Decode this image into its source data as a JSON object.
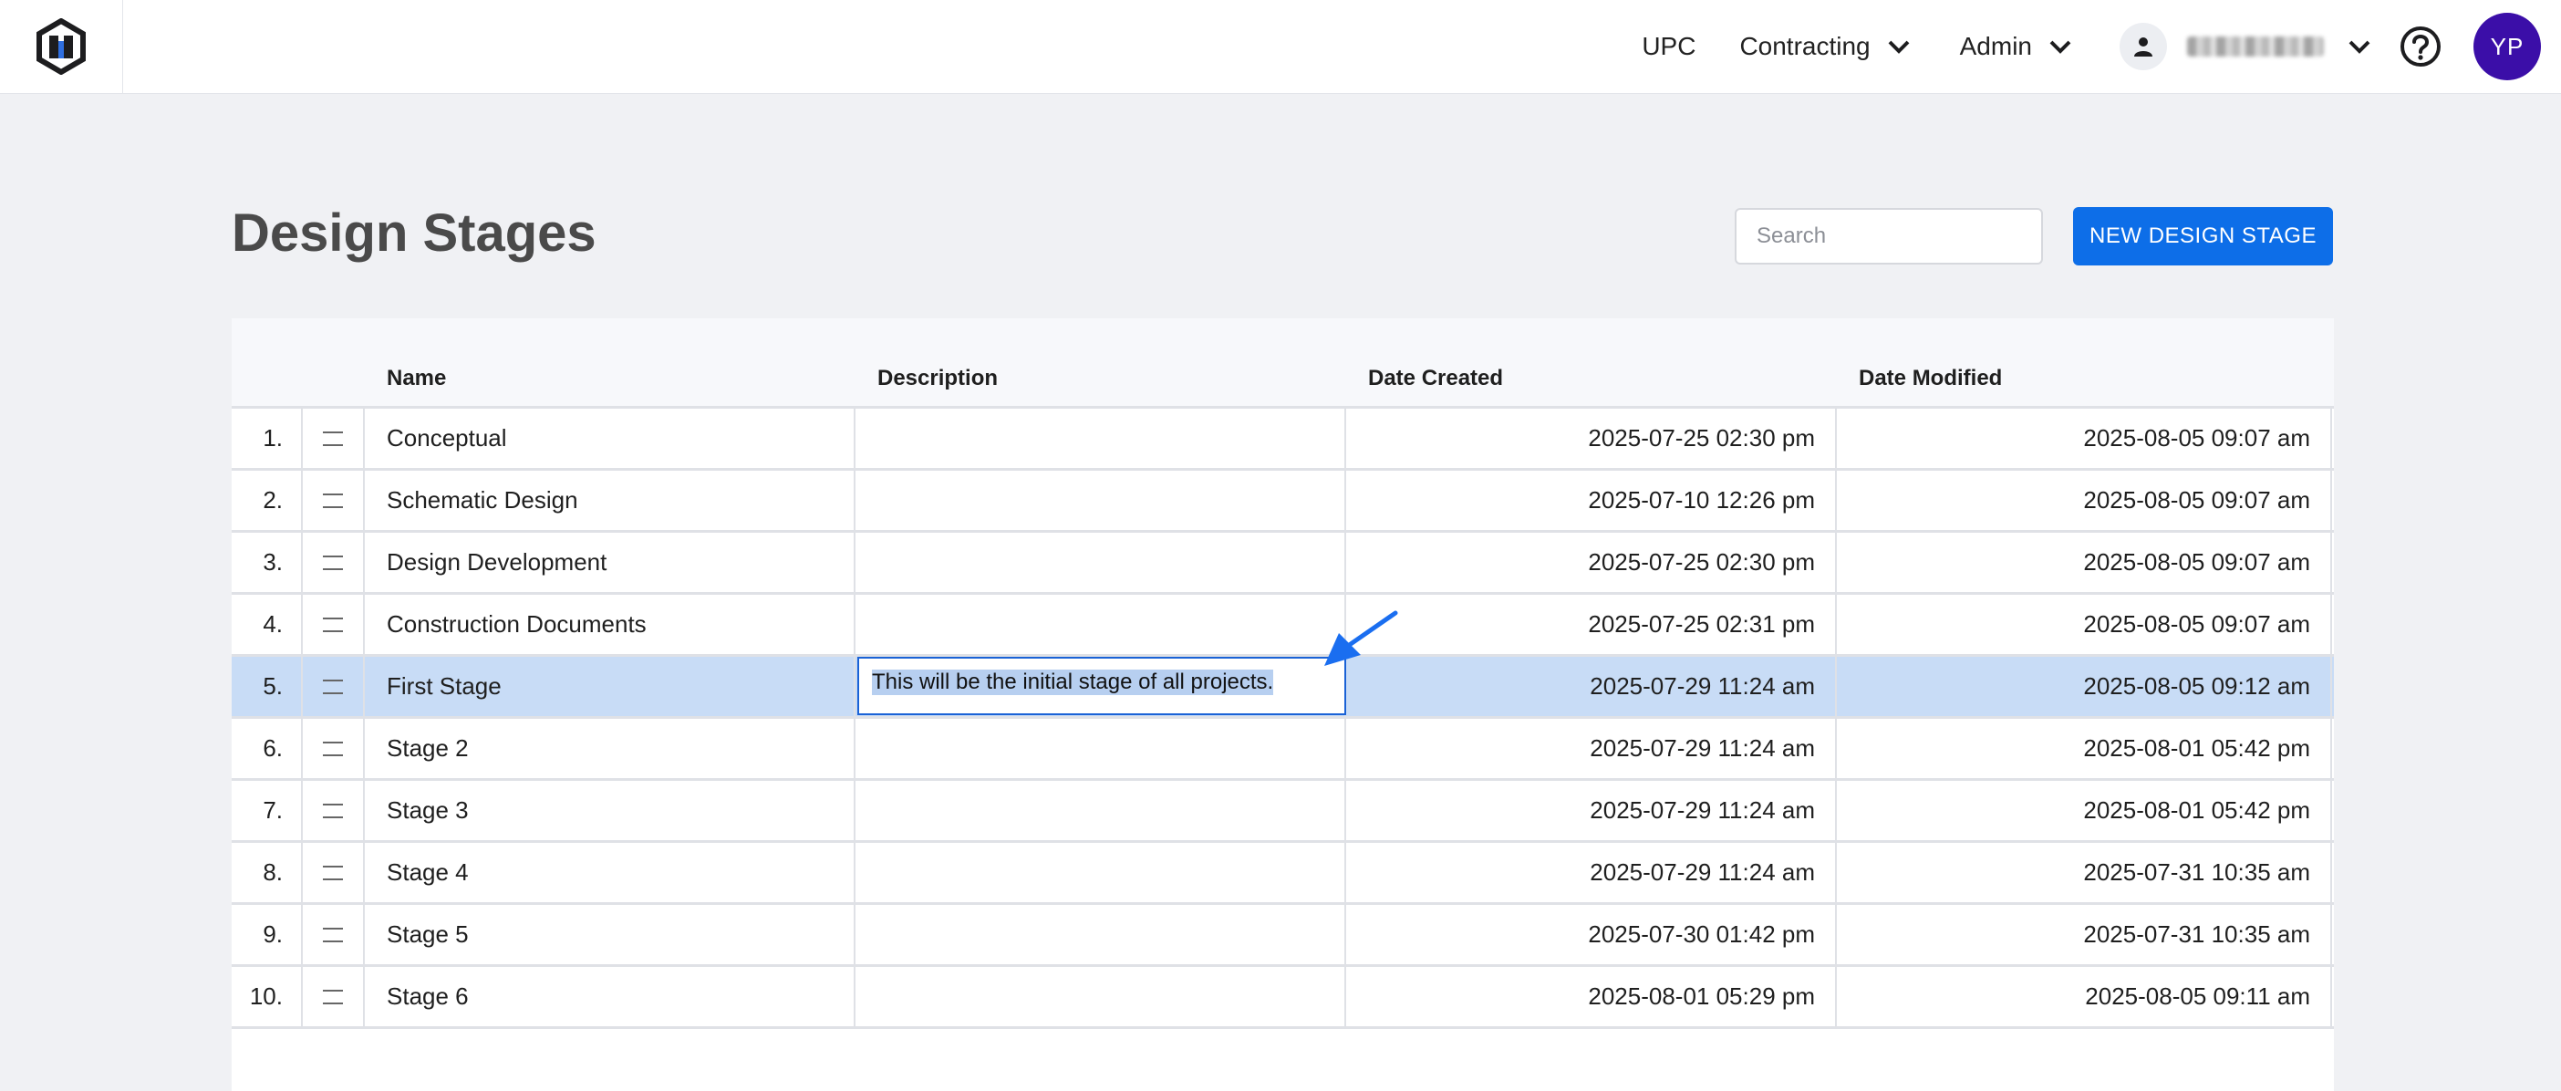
{
  "nav": {
    "upc": "UPC",
    "contracting": "Contracting",
    "admin": "Admin",
    "avatar_initials": "YP",
    "icons": {
      "logo": "brand-logo",
      "user": "user-icon",
      "help": "help-circle-icon",
      "chevron": "chevron-down-icon"
    }
  },
  "header": {
    "title": "Design Stages",
    "search_placeholder": "Search",
    "new_button": "NEW DESIGN STAGE"
  },
  "table": {
    "columns": {
      "name": "Name",
      "description": "Description",
      "created": "Date Created",
      "modified": "Date Modified"
    },
    "rows": [
      {
        "num": "1.",
        "name": "Conceptual",
        "description": "",
        "created": "2025-07-25 02:30 pm",
        "modified": "2025-08-05 09:07 am"
      },
      {
        "num": "2.",
        "name": "Schematic Design",
        "description": "",
        "created": "2025-07-10 12:26 pm",
        "modified": "2025-08-05 09:07 am"
      },
      {
        "num": "3.",
        "name": "Design Development",
        "description": "",
        "created": "2025-07-25 02:30 pm",
        "modified": "2025-08-05 09:07 am"
      },
      {
        "num": "4.",
        "name": "Construction Documents",
        "description": "",
        "created": "2025-07-25 02:31 pm",
        "modified": "2025-08-05 09:07 am"
      },
      {
        "num": "5.",
        "name": "First Stage",
        "description": "This will be the initial stage of all projects.",
        "created": "2025-07-29 11:24 am",
        "modified": "2025-08-05 09:12 am"
      },
      {
        "num": "6.",
        "name": "Stage 2",
        "description": "",
        "created": "2025-07-29 11:24 am",
        "modified": "2025-08-01 05:42 pm"
      },
      {
        "num": "7.",
        "name": "Stage 3",
        "description": "",
        "created": "2025-07-29 11:24 am",
        "modified": "2025-08-01 05:42 pm"
      },
      {
        "num": "8.",
        "name": "Stage 4",
        "description": "",
        "created": "2025-07-29 11:24 am",
        "modified": "2025-07-31 10:35 am"
      },
      {
        "num": "9.",
        "name": "Stage 5",
        "description": "",
        "created": "2025-07-30 01:42 pm",
        "modified": "2025-07-31 10:35 am"
      },
      {
        "num": "10.",
        "name": "Stage 6",
        "description": "",
        "created": "2025-08-01 05:29 pm",
        "modified": "2025-08-05 09:11 am"
      }
    ]
  },
  "colors": {
    "accent": "#0d6ee8",
    "avatar": "#3b0ea8",
    "selected_row": "#c8dcf6",
    "annotation_arrow": "#1a6ef0"
  }
}
